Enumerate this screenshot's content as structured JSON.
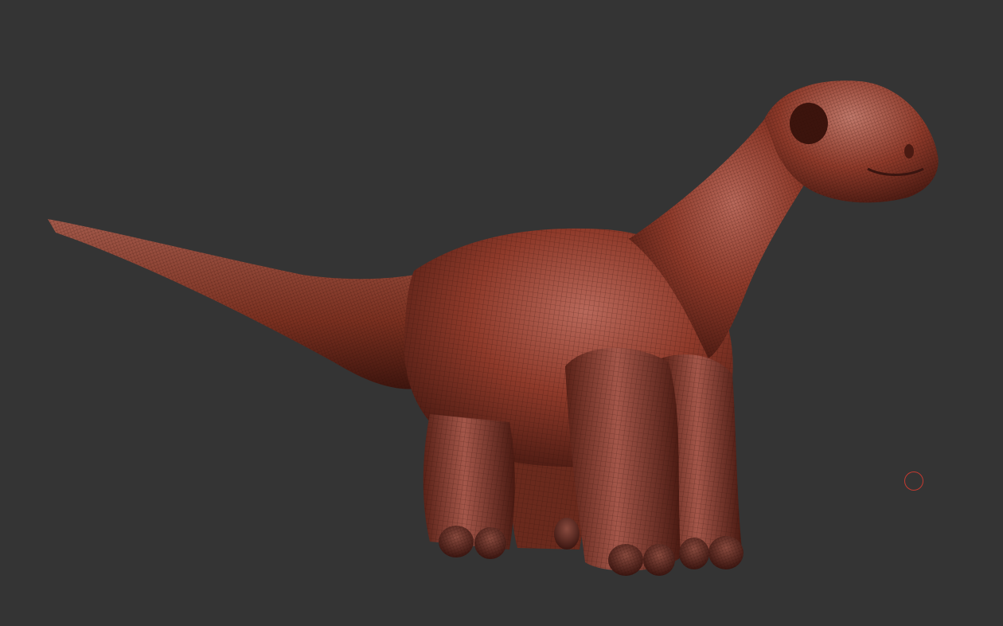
{
  "viewport": {
    "background_color": "#343434",
    "display_mode": "polyframe",
    "model": {
      "subject": "dinosaur-sculpt",
      "material_color": "#8e3a2a",
      "highlight_color": "#c98576",
      "shadow_color": "#3a1510",
      "wireframe_color": "#2a0c07"
    },
    "brush_cursor": {
      "icon": "brush-circle-icon",
      "color": "#c43a30"
    }
  }
}
